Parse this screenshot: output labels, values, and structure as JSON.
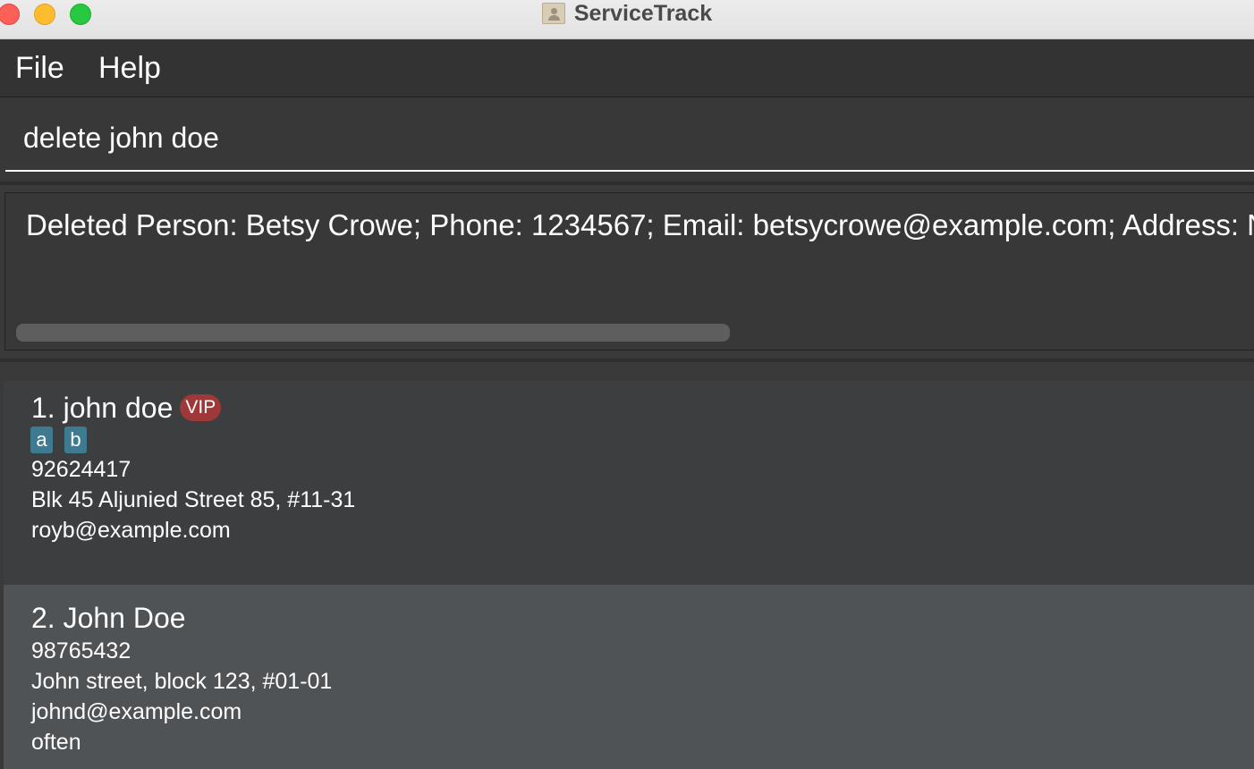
{
  "window": {
    "title": "ServiceTrack"
  },
  "menu": {
    "file": "File",
    "help": "Help"
  },
  "command": {
    "value": "delete john doe"
  },
  "result": {
    "text": "Deleted Person: Betsy Crowe; Phone: 1234567; Email: betsycrowe@example.com; Address: Ne"
  },
  "persons": [
    {
      "name": "1. john doe",
      "badge": "VIP",
      "tags": [
        "a",
        "b"
      ],
      "phone": "92624417",
      "address": "Blk 45 Aljunied Street 85, #11-31",
      "email": "royb@example.com"
    },
    {
      "name": "2. John Doe",
      "phone": "98765432",
      "address": "John street, block 123, #01-01",
      "email": "johnd@example.com",
      "remark": "often"
    }
  ],
  "colors": {
    "background": "#3a3a3a",
    "vip_badge": "#9f3838",
    "tag": "#3e7b91",
    "selected_card": "#4f5356"
  }
}
